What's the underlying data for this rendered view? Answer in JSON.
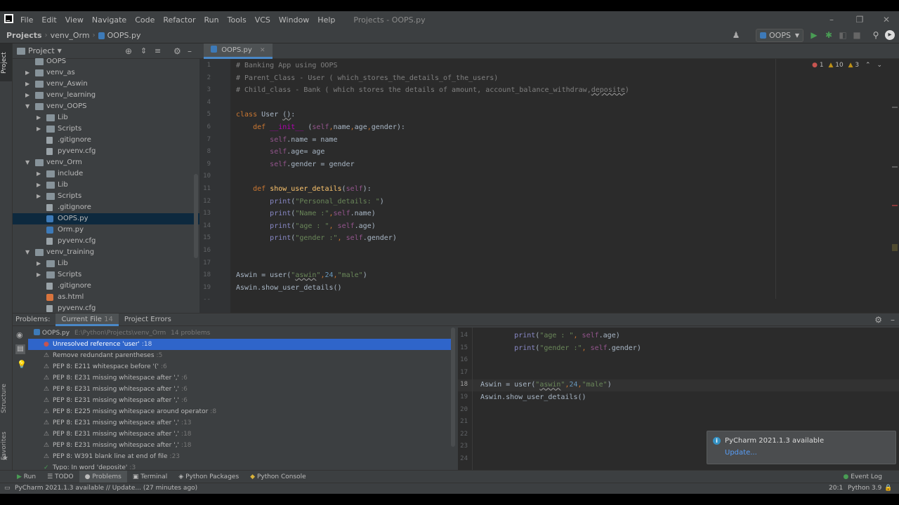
{
  "menu": {
    "app_icon": "pycharm-logo",
    "items": [
      "File",
      "Edit",
      "View",
      "Navigate",
      "Code",
      "Refactor",
      "Run",
      "Tools",
      "VCS",
      "Window",
      "Help"
    ],
    "window_title": "Projects - OOPS.py"
  },
  "navbar": {
    "crumbs": [
      "Projects",
      "venv_Orm",
      "OOPS.py"
    ],
    "run_config": "OOPS"
  },
  "left_strip": {
    "project": "Project",
    "structure": "Structure",
    "favorites": "Favorites"
  },
  "project_panel": {
    "title": "Project",
    "tree": [
      {
        "name": "OOPS",
        "type": "folder",
        "depth": 1,
        "arrow": ""
      },
      {
        "name": "venv_as",
        "type": "folder",
        "depth": 1,
        "arrow": "▶"
      },
      {
        "name": "venv_Aswin",
        "type": "folder",
        "depth": 1,
        "arrow": "▶"
      },
      {
        "name": "venv_learning",
        "type": "folder",
        "depth": 1,
        "arrow": "▶"
      },
      {
        "name": "venv_OOPS",
        "type": "folder",
        "depth": 1,
        "arrow": "▼"
      },
      {
        "name": "Lib",
        "type": "folder",
        "depth": 2,
        "arrow": "▶"
      },
      {
        "name": "Scripts",
        "type": "folder",
        "depth": 2,
        "arrow": "▶"
      },
      {
        "name": ".gitignore",
        "type": "file",
        "depth": 2,
        "arrow": ""
      },
      {
        "name": "pyvenv.cfg",
        "type": "file",
        "depth": 2,
        "arrow": ""
      },
      {
        "name": "venv_Orm",
        "type": "folder",
        "depth": 1,
        "arrow": "▼"
      },
      {
        "name": "include",
        "type": "folder",
        "depth": 2,
        "arrow": "▶"
      },
      {
        "name": "Lib",
        "type": "folder",
        "depth": 2,
        "arrow": "▶"
      },
      {
        "name": "Scripts",
        "type": "folder",
        "depth": 2,
        "arrow": "▶"
      },
      {
        "name": ".gitignore",
        "type": "file",
        "depth": 2,
        "arrow": ""
      },
      {
        "name": "OOPS.py",
        "type": "py",
        "depth": 2,
        "arrow": "",
        "selected": true
      },
      {
        "name": "Orm.py",
        "type": "py",
        "depth": 2,
        "arrow": ""
      },
      {
        "name": "pyvenv.cfg",
        "type": "file",
        "depth": 2,
        "arrow": ""
      },
      {
        "name": "venv_training",
        "type": "folder",
        "depth": 1,
        "arrow": "▼"
      },
      {
        "name": "Lib",
        "type": "folder",
        "depth": 2,
        "arrow": "▶"
      },
      {
        "name": "Scripts",
        "type": "folder",
        "depth": 2,
        "arrow": "▶"
      },
      {
        "name": ".gitignore",
        "type": "file",
        "depth": 2,
        "arrow": ""
      },
      {
        "name": "as.html",
        "type": "html",
        "depth": 2,
        "arrow": ""
      },
      {
        "name": "pyvenv.cfg",
        "type": "file",
        "depth": 2,
        "arrow": ""
      }
    ]
  },
  "editor": {
    "tab": "OOPS.py",
    "inspection": {
      "errors": "1",
      "warnings": "10",
      "weak": "3"
    },
    "lines": [
      {
        "n": "1",
        "html": "<span class='cm'># Banking App using OOPS</span>"
      },
      {
        "n": "2",
        "html": "<span class='cm'># Parent_Class - User ( which_stores_the_details_of_the_users)</span>"
      },
      {
        "n": "3",
        "html": "<span class='cm'># Child_class - Bank ( which stores the details of amount, account_balance_withdraw,<span class='ul'>deposite</span>)</span>"
      },
      {
        "n": "4",
        "html": ""
      },
      {
        "n": "5",
        "html": "<span class='kw'>class</span> User <span class='ul'>()</span>:"
      },
      {
        "n": "6",
        "html": "    <span class='kw'>def</span> <span class='mg'>__init__</span> (<span class='sf'>self</span><span class='kw'>,</span>name<span class='kw'>,</span>age<span class='kw'>,</span>gender):"
      },
      {
        "n": "7",
        "html": "        <span class='sf'>self</span>.name = name"
      },
      {
        "n": "8",
        "html": "        <span class='sf'>self</span>.age= age"
      },
      {
        "n": "9",
        "html": "        <span class='sf'>self</span>.gender = gender"
      },
      {
        "n": "10",
        "html": ""
      },
      {
        "n": "11",
        "html": "    <span class='kw'>def</span> <span class='fn'>show_user_details</span>(<span class='sf'>self</span>):"
      },
      {
        "n": "12",
        "html": "        <span class='bi'>print</span>(<span class='st'>\"Personal_details: \"</span>)"
      },
      {
        "n": "13",
        "html": "        <span class='bi'>print</span>(<span class='st'>\"Name :\"</span><span class='kw'>,</span><span class='sf'>self</span>.name)"
      },
      {
        "n": "14",
        "html": "        <span class='bi'>print</span>(<span class='st'>\"age : \"</span><span class='kw'>,</span> <span class='sf'>self</span>.age)"
      },
      {
        "n": "15",
        "html": "        <span class='bi'>print</span>(<span class='st'>\"gender :\"</span><span class='kw'>,</span> <span class='sf'>self</span>.gender)"
      },
      {
        "n": "16",
        "html": ""
      },
      {
        "n": "17",
        "html": ""
      },
      {
        "n": "18",
        "html": "Aswin = user(<span class='st'>\"<span class='ul'>aswin</span>\"</span><span class='kw'>,</span><span class='nu'>24</span><span class='kw'>,</span><span class='st'>\"male\"</span>)"
      },
      {
        "n": "19",
        "html": "Aswin.show_user_details()"
      }
    ]
  },
  "problems": {
    "label": "Problems:",
    "tabs": [
      {
        "label": "Current File",
        "count": "14"
      },
      {
        "label": "Project Errors",
        "count": ""
      }
    ],
    "file": {
      "name": "OOPS.py",
      "path": "E:\\Python\\Projects\\venv_Orm",
      "summary": "14 problems"
    },
    "items": [
      {
        "kind": "error",
        "text": "Unresolved reference 'user'",
        "loc": ":18",
        "selected": true
      },
      {
        "kind": "weak",
        "text": "Remove redundant parentheses",
        "loc": ":5"
      },
      {
        "kind": "warn",
        "text": "PEP 8: E211 whitespace before '('",
        "loc": ":6"
      },
      {
        "kind": "warn",
        "text": "PEP 8: E231 missing whitespace after ','",
        "loc": ":6"
      },
      {
        "kind": "warn",
        "text": "PEP 8: E231 missing whitespace after ','",
        "loc": ":6"
      },
      {
        "kind": "warn",
        "text": "PEP 8: E231 missing whitespace after ','",
        "loc": ":6"
      },
      {
        "kind": "warn",
        "text": "PEP 8: E225 missing whitespace around operator",
        "loc": ":8"
      },
      {
        "kind": "warn",
        "text": "PEP 8: E231 missing whitespace after ','",
        "loc": ":13"
      },
      {
        "kind": "warn",
        "text": "PEP 8: E231 missing whitespace after ','",
        "loc": ":18"
      },
      {
        "kind": "warn",
        "text": "PEP 8: E231 missing whitespace after ','",
        "loc": ":18"
      },
      {
        "kind": "warn",
        "text": "PEP 8: W391 blank line at end of file",
        "loc": ":23"
      },
      {
        "kind": "typo",
        "text": "Typo: In word 'deposite'",
        "loc": ":3"
      }
    ],
    "preview": [
      {
        "n": "14",
        "html": "        <span class='bi'>print</span>(<span class='st'>\"age : \"</span><span class='kw'>,</span> <span class='sf'>self</span>.age)",
        "hl": false
      },
      {
        "n": "15",
        "html": "        <span class='bi'>print</span>(<span class='st'>\"gender :\"</span><span class='kw'>,</span> <span class='sf'>self</span>.gender)",
        "hl": false
      },
      {
        "n": "16",
        "html": "",
        "hl": false
      },
      {
        "n": "17",
        "html": "",
        "hl": false
      },
      {
        "n": "18",
        "html": "Aswin = user(<span class='st'>\"<span class='ul'>aswin</span>\"</span><span class='kw'>,</span><span class='nu'>24</span><span class='kw'>,</span><span class='st'>\"male\"</span>)",
        "hl": true
      },
      {
        "n": "19",
        "html": "Aswin.show_user_details()",
        "hl": false
      },
      {
        "n": "20",
        "html": "",
        "hl": false
      },
      {
        "n": "21",
        "html": "",
        "hl": false
      },
      {
        "n": "22",
        "html": "",
        "hl": false
      },
      {
        "n": "23",
        "html": "",
        "hl": false
      },
      {
        "n": "24",
        "html": "",
        "hl": false
      }
    ]
  },
  "notification": {
    "title": "PyCharm 2021.1.3 available",
    "link": "Update..."
  },
  "bottom_tabs": [
    "Run",
    "TODO",
    "Problems",
    "Terminal",
    "Python Packages",
    "Python Console"
  ],
  "event_log": "Event Log",
  "status": {
    "message": "PyCharm 2021.1.3 available // Update... (27 minutes ago)",
    "position": "20:1",
    "interpreter": "Python 3.9"
  },
  "colors": {
    "accent": "#4a88c7",
    "selection": "#2f65ca",
    "error": "#c75450",
    "warning": "#be9117"
  }
}
